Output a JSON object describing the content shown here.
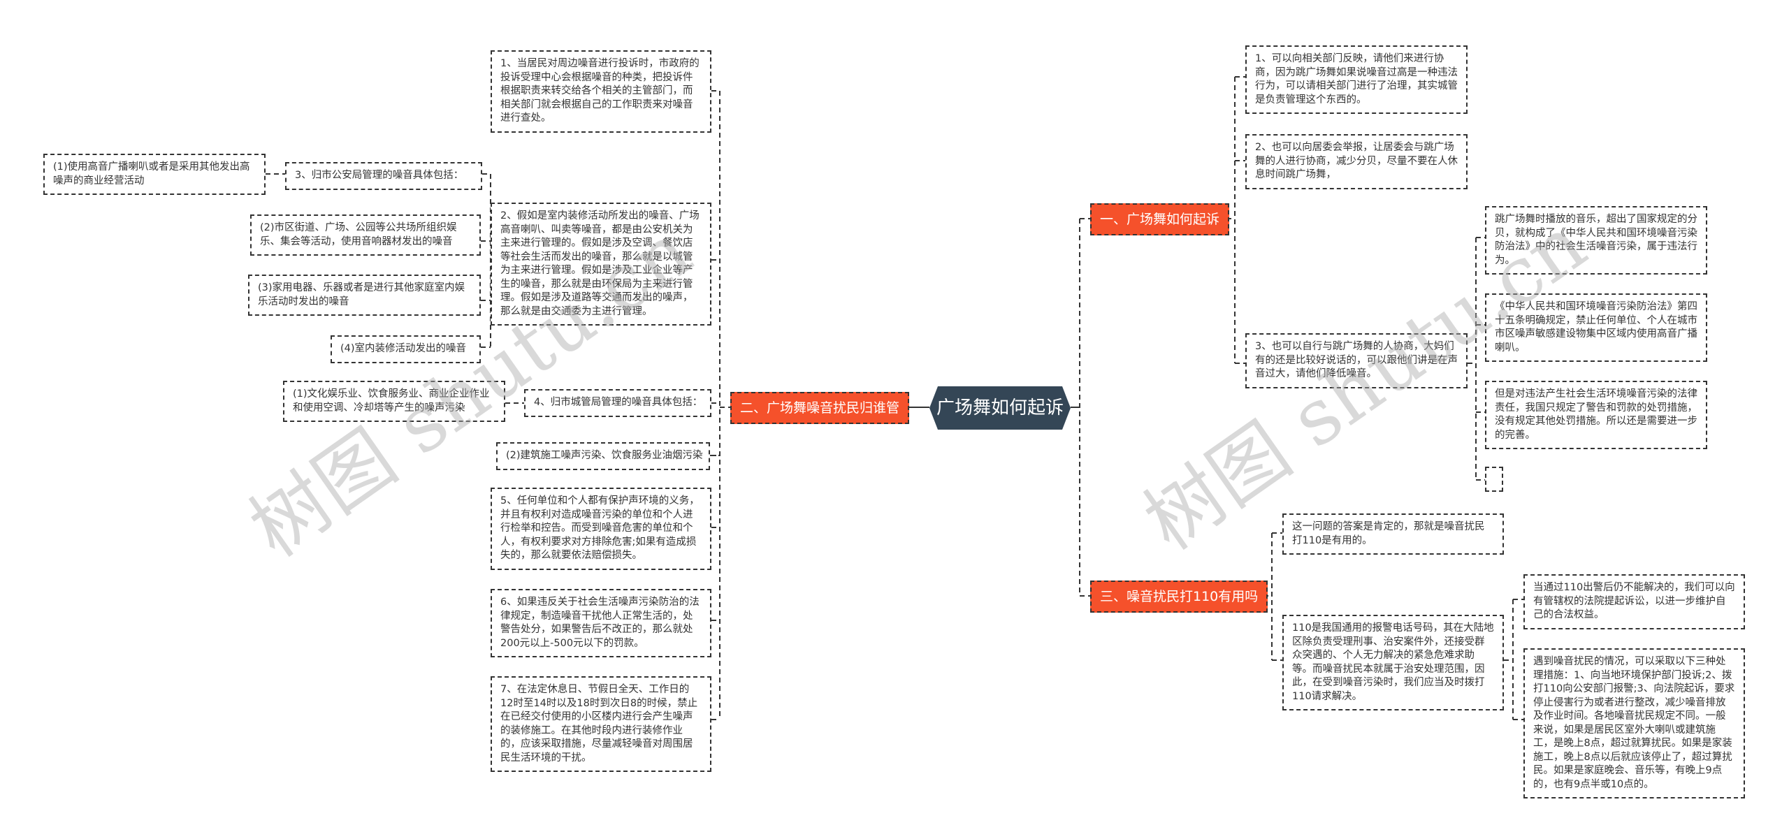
{
  "center": {
    "title": "广场舞如何起诉"
  },
  "branches": {
    "b1": {
      "label": "一、广场舞如何起诉",
      "items": [
        "1、可以向相关部门反映，请他们来进行协商，因为跳广场舞如果说噪音过高是一种违法行为，可以请相关部门进行了治理，其实城管是负责管理这个东西的。",
        "2、也可以向居委会举报，让居委会与跳广场舞的人进行协商，减少分贝，尽量不要在人休息时间跳广场舞，",
        "3、也可以自行与跳广场舞的人协商，大妈们有的还是比较好说话的，可以跟他们讲是在声音过大，请他们降低噪音。"
      ],
      "sub3": [
        "跳广场舞时播放的音乐，超出了国家规定的分贝，就构成了《中华人民共和国环境噪音污染防治法》中的社会生活噪音污染，属于违法行为。",
        "《中华人民共和国环境噪音污染防治法》第四十五条明确规定，禁止任何单位、个人在城市市区噪声敏感建设物集中区域内使用高音广播喇叭。",
        "但是对违法产生社会生活环境噪音污染的法律责任，我国只规定了警告和罚款的处罚措施，没有规定其他处罚措施。所以还是需要进一步的完善。",
        ""
      ]
    },
    "b2": {
      "label": "二、广场舞噪音扰民归谁管",
      "items": [
        "1、当居民对周边噪音进行投诉时，市政府的投诉受理中心会根据噪音的种类，把投诉件根据职责来转交给各个相关的主管部门，而相关部门就会根据自己的工作职责来对噪音进行查处。",
        "2、假如是室内装修活动所发出的噪音、广场高音喇叭、叫卖等噪音，都是由公安机关为主来进行管理的。假如是涉及空调、餐饮店等社会生活而发出的噪音，那么就是以城管为主来进行管理。假如是涉及工业企业等产生的噪音，那么就是由环保局为主来进行管理。假如是涉及道路等交通而发出的噪声，那么就是由交通委为主进行管理。",
        "3、归市公安局管理的噪音具体包括：",
        "4、归市城管局管理的噪音具体包括：",
        "5、任何单位和个人都有保护声环境的义务，并且有权利对造成噪音污染的单位和个人进行检举和控告。而受到噪音危害的单位和个人，有权利要求对方排除危害;如果有造成损失的，那么就要依法赔偿损失。",
        "6、如果违反关于社会生活噪声污染防治的法律规定，制造噪音干扰他人正常生活的，处警告处分，如果警告后不改正的，那么就处200元以上-500元以下的罚款。",
        "7、在法定休息日、节假日全天、工作日的12时至14时以及18时到次日8的时候，禁止在已经交付使用的小区楼内进行会产生噪声的装修施工。在其他时段内进行装修作业的，应该采取措施，尽量减轻噪音对周围居民生活环境的干扰。"
      ],
      "police_items": [
        "(1)使用高音广播喇叭或者是采用其他发出高噪声的商业经营活动",
        "(2)市区街道、广场、公园等公共场所组织娱乐、集会等活动，使用音响器材发出的噪音",
        "(3)家用电器、乐器或者是进行其他家庭室内娱乐活动时发出的噪音",
        "(4)室内装修活动发出的噪音"
      ],
      "urban_items": [
        "(1)文化娱乐业、饮食服务业、商业企业作业和使用空调、冷却塔等产生的噪声污染",
        "(2)建筑施工噪声污染、饮食服务业油烟污染"
      ]
    },
    "b3": {
      "label": "三、噪音扰民打110有用吗",
      "items": [
        "这一问题的答案是肯定的，那就是噪音扰民打110是有用的。",
        "110是我国通用的报警电话号码，其在大陆地区除负责受理刑事、治安案件外，还接受群众突遇的、个人无力解决的紧急危难求助等。而噪音扰民本就属于治安处理范围，因此，在受到噪音污染时，我们应当及时拨打110请求解决。"
      ],
      "sub2": [
        "当通过110出警后仍不能解决的，我们可以向有管辖权的法院提起诉讼，以进一步维护自己的合法权益。",
        "遇到噪音扰民的情况，可以采取以下三种处理措施：1、向当地环境保护部门投诉;2、拨打110向公安部门报警;3、向法院起诉，要求停止侵害行为或者进行整改，减少噪音排放及作业时间。各地噪音扰民规定不同。一般来说，如果是居民区室外大喇叭或建筑施工，是晚上8点，超过就算扰民。如果是家装施工，晚上8点以后就应该停止了，超过算扰民。如果是家庭晚会、音乐等，有晚上9点的，也有9点半或10点的。"
      ]
    }
  },
  "watermark": {
    "left": "树图 shutu.cn",
    "right": "树图 shutu.cn"
  },
  "colors": {
    "branch": "#f5512b",
    "center": "#344656",
    "line": "#333333"
  }
}
